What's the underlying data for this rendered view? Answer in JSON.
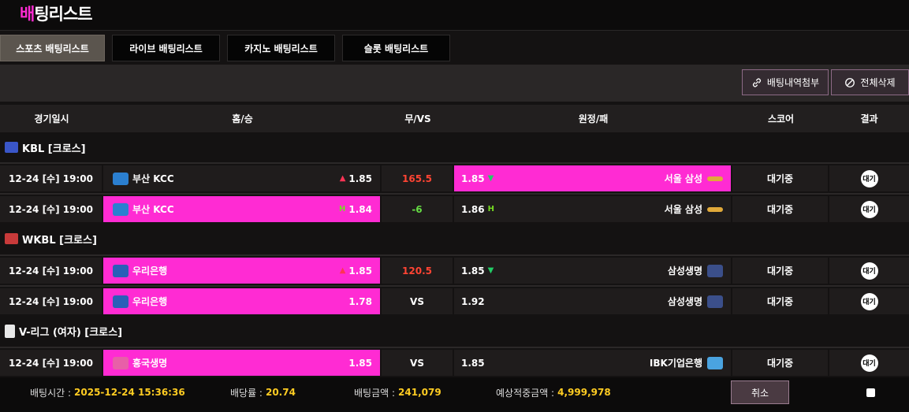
{
  "header": {
    "title_accent": "배",
    "title_rest": "팅리스트"
  },
  "tabs": [
    {
      "label": "스포츠 배팅리스트",
      "active": true
    },
    {
      "label": "라이브 배팅리스트",
      "active": false
    },
    {
      "label": "카지노 배팅리스트",
      "active": false
    },
    {
      "label": "슬롯 배팅리스트",
      "active": false
    }
  ],
  "toolbar": {
    "attach_label": "배팅내역첨부",
    "delete_all_label": "전체삭제"
  },
  "table": {
    "headers": {
      "date": "경기일시",
      "home": "홈/승",
      "draw": "무/VS",
      "away": "원정/패",
      "score": "스코어",
      "result": "결과"
    }
  },
  "leagues": [
    {
      "name": "KBL [크로스]",
      "logo_color": "#3a56c8"
    },
    {
      "name": "WKBL [크로스]",
      "logo_color": "#c83a3a"
    },
    {
      "name": "V-리그 (여자) [크로스]",
      "logo_color": "#e8e8e8"
    }
  ],
  "rows": [
    {
      "date": "12-24 [수] 19:00",
      "home": "부산 KCC",
      "home_odds": "1.85",
      "home_mark": "▲",
      "mid": "165.5",
      "away_odds": "1.85",
      "away_mark": "▼",
      "away": "서울 삼성",
      "score": "대기중",
      "result": "대기",
      "selected": "away"
    },
    {
      "date": "12-24 [수] 19:00",
      "home": "부산 KCC",
      "home_odds": "1.84",
      "home_mark": "H",
      "mid": "-6",
      "away_odds": "1.86",
      "away_mark": "H",
      "away": "서울 삼성",
      "score": "대기중",
      "result": "대기",
      "selected": "home"
    },
    {
      "date": "12-24 [수] 19:00",
      "home": "우리은행",
      "home_odds": "1.85",
      "home_mark": "▲",
      "mid": "120.5",
      "away_odds": "1.85",
      "away_mark": "▼",
      "away": "삼성생명",
      "score": "대기중",
      "result": "대기",
      "selected": "home"
    },
    {
      "date": "12-24 [수] 19:00",
      "home": "우리은행",
      "home_odds": "1.78",
      "home_mark": "",
      "mid": "VS",
      "away_odds": "1.92",
      "away_mark": "",
      "away": "삼성생명",
      "score": "대기중",
      "result": "대기",
      "selected": "home"
    },
    {
      "date": "12-24 [수] 19:00",
      "home": "흥국생명",
      "home_odds": "1.85",
      "home_mark": "",
      "mid": "VS",
      "away_odds": "1.85",
      "away_mark": "",
      "away": "IBK기업은행",
      "score": "대기중",
      "result": "대기",
      "selected": "home"
    }
  ],
  "footer": {
    "bet_time_label": "배팅시간 :",
    "bet_time": "2025-12-24 15:36:36",
    "odds_label": "배당률 :",
    "odds": "20.74",
    "amount_label": "배팅금액 :",
    "amount": "241,079",
    "expected_label": "예상적중금액 :",
    "expected": "4,999,978",
    "cancel_label": "취소"
  },
  "colors": {
    "accent": "#ff2bd3",
    "up": "#ff3355",
    "down": "#22cc66",
    "amount": "#ffcc22"
  }
}
